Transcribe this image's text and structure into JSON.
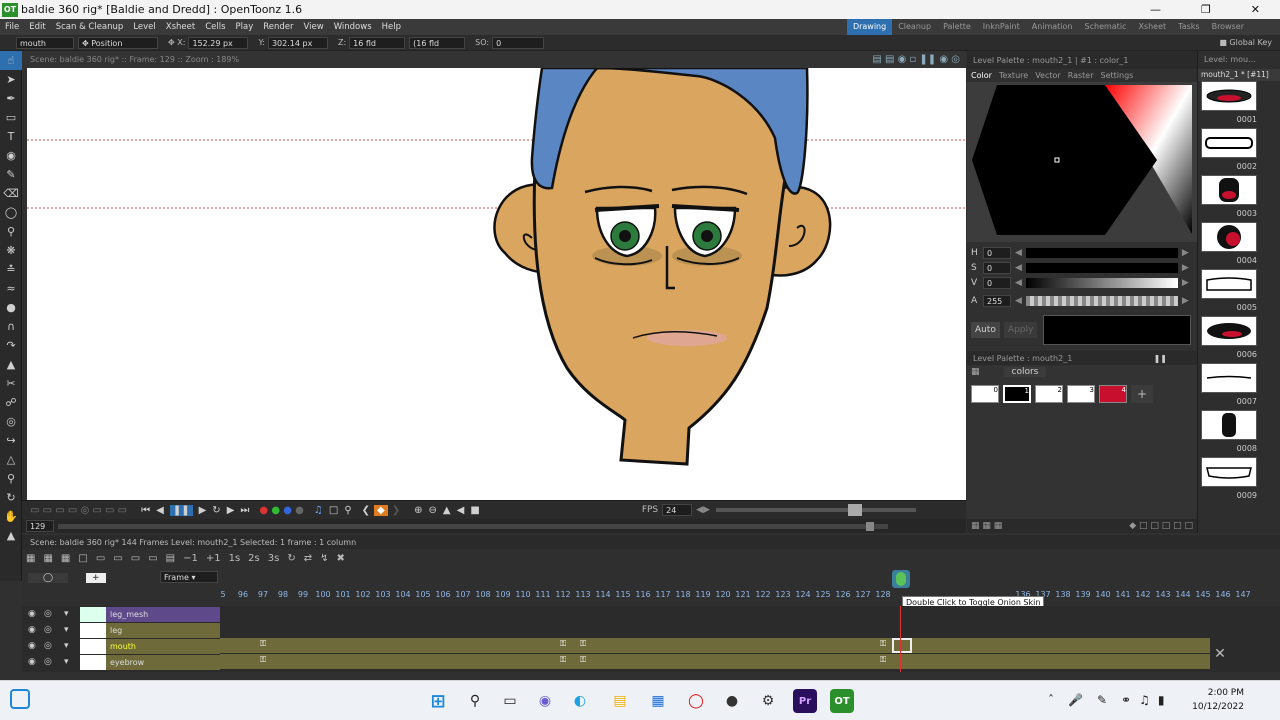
{
  "window": {
    "title": "baldie 360 rig* [Baldie and Dredd] : OpenToonz 1.6",
    "app_badge": "OT"
  },
  "menu": [
    "File",
    "Edit",
    "Scan & Cleanup",
    "Level",
    "Xsheet",
    "Cells",
    "Play",
    "Render",
    "View",
    "Windows",
    "Help"
  ],
  "rooms": {
    "items": [
      "Drawing",
      "Cleanup",
      "Palette",
      "InknPaint",
      "Animation",
      "Schematic",
      "Xsheet",
      "Tasks",
      "Browser"
    ],
    "active": "Drawing"
  },
  "tool_options": {
    "object": "mouth",
    "mode": "Position",
    "x_label": "X:",
    "x_value": "152.29 px",
    "y_label": "Y:",
    "y_value": "302.14 px",
    "z_label": "Z:",
    "z_value": "16 fld",
    "z2_value": "(16 fld",
    "so_label": "SO:",
    "so_value": "0",
    "global_key": "Global Key"
  },
  "viewer": {
    "header": "Scene: baldie 360 rig*  ::  Frame: 129  ::  Zoom : 189%",
    "fps_label": "FPS",
    "fps_value": "24",
    "frame_value": "129"
  },
  "style_editor": {
    "header": "Level Palette : mouth2_1 | #1 : color_1",
    "tabs": [
      "Color",
      "Texture",
      "Vector",
      "Raster",
      "Settings"
    ],
    "sliders": [
      {
        "label": "H",
        "value": "0"
      },
      {
        "label": "S",
        "value": "0"
      },
      {
        "label": "V",
        "value": "0"
      },
      {
        "label": "A",
        "value": "255"
      }
    ],
    "auto_label": "Auto",
    "apply_label": "Apply",
    "current_color": "#000000"
  },
  "palette": {
    "header": "Level Palette : mouth2_1",
    "page": "colors",
    "chips": [
      {
        "index": "0",
        "color": "#ffffff"
      },
      {
        "index": "1",
        "color": "#000000"
      },
      {
        "index": "2",
        "color": "#ffffff"
      },
      {
        "index": "3",
        "color": "#ffffff"
      },
      {
        "index": "4",
        "color": "#c8102e"
      }
    ]
  },
  "level_strip": {
    "header": "Level: mou...",
    "level": "mouth2_1 * [#11]",
    "frames": [
      "0001",
      "0002",
      "0003",
      "0004",
      "0005",
      "0006",
      "0007",
      "0008",
      "0009"
    ]
  },
  "timeline": {
    "header": "Scene: baldie 360 rig*     144 Frames  Level: mouth2_1   Selected: 1 frame : 1 column",
    "frame_zoom": "Frame",
    "ruler": [
      "5",
      "96",
      "97",
      "98",
      "99",
      "100",
      "101",
      "102",
      "103",
      "104",
      "105",
      "106",
      "107",
      "108",
      "109",
      "110",
      "111",
      "112",
      "113",
      "114",
      "115",
      "116",
      "117",
      "118",
      "119",
      "120",
      "121",
      "122",
      "123",
      "124",
      "125",
      "126",
      "127",
      "128",
      "",
      "",
      "",
      "",
      "",
      "",
      "136",
      "137",
      "138",
      "139",
      "140",
      "141",
      "142",
      "143",
      "144",
      "145",
      "146",
      "147"
    ],
    "layers": [
      {
        "name": "leg_mesh",
        "color": "#5e4a8a"
      },
      {
        "name": "leg",
        "color": "#6e6a3a"
      },
      {
        "name": "mouth",
        "color": "#6e6a3a",
        "active": true
      },
      {
        "name": "eyebrow",
        "color": "#6e6a3a"
      }
    ],
    "tooltip": "Double Click to Toggle Onion Skin"
  },
  "taskbar": {
    "time": "2:00 PM",
    "date": "10/12/2022"
  }
}
